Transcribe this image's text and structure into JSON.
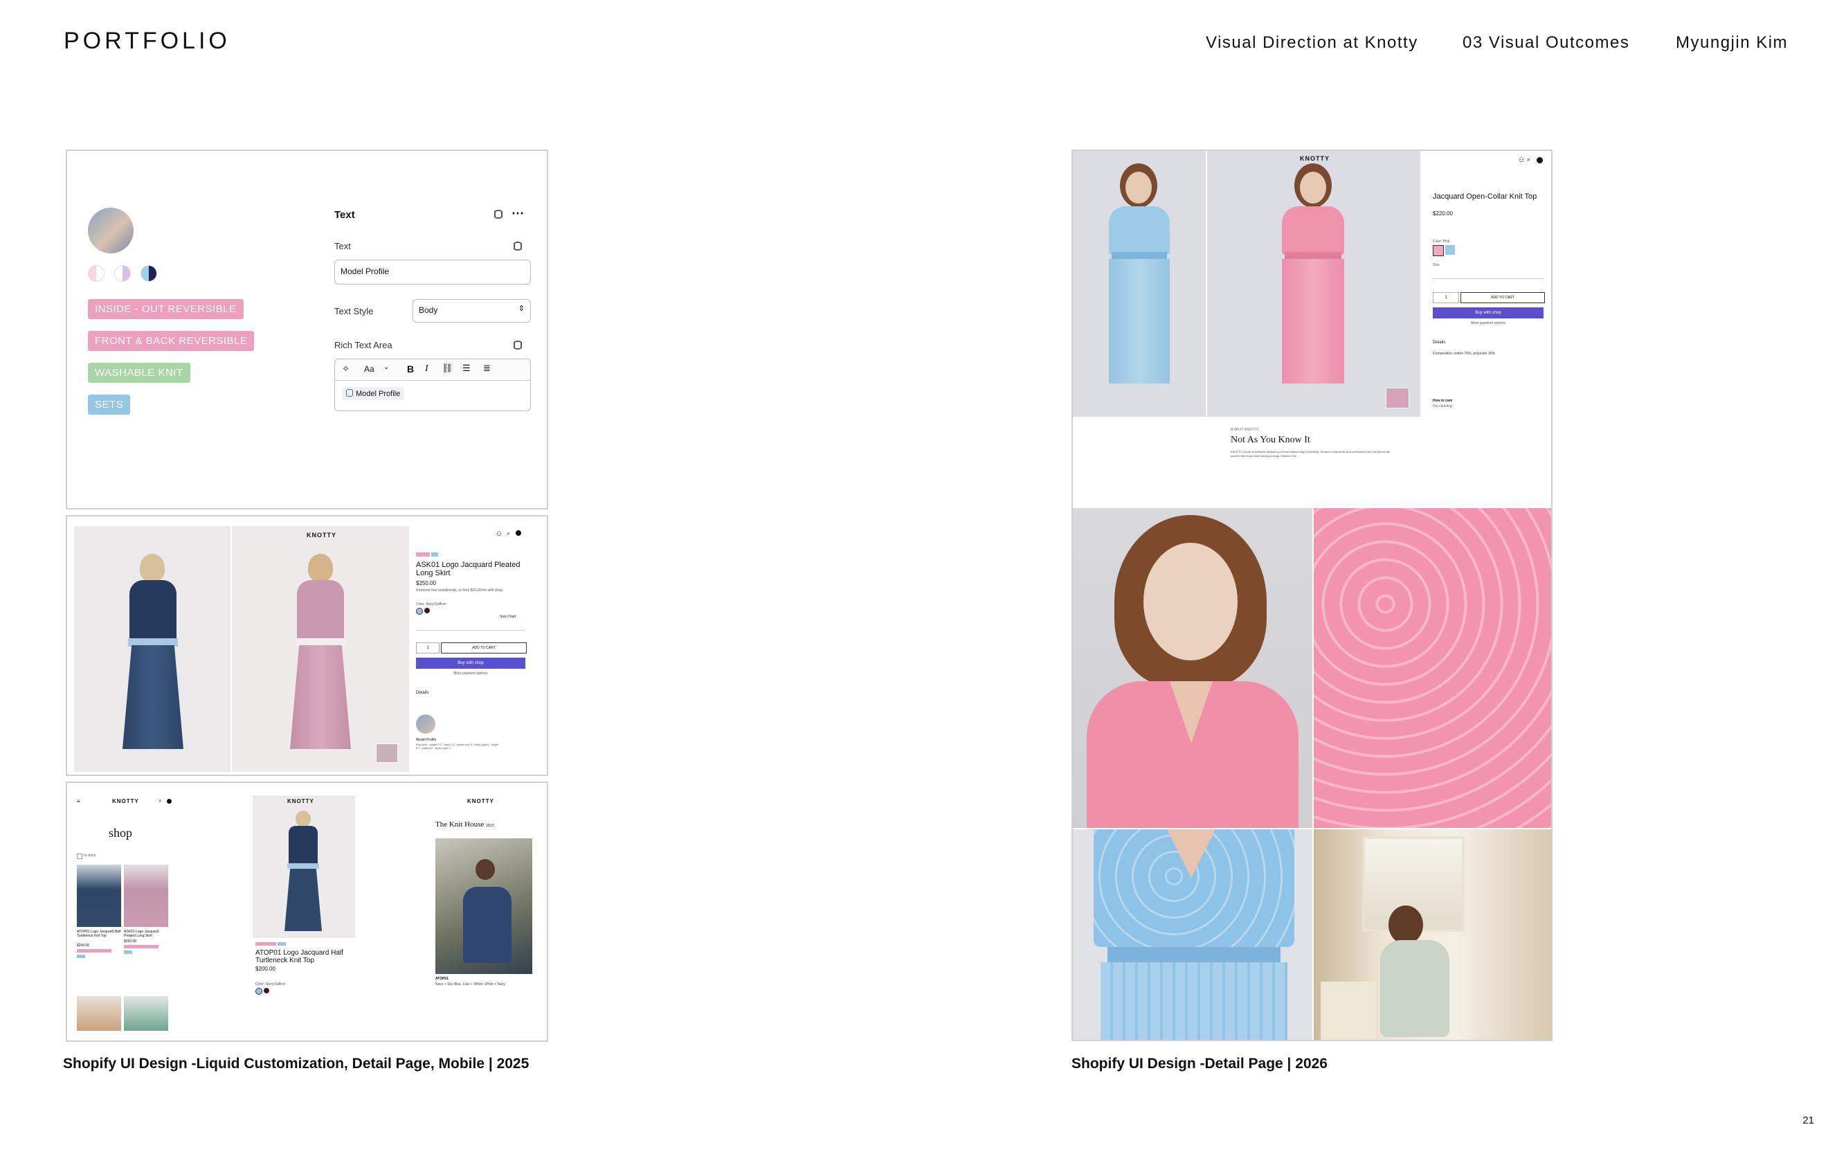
{
  "header": {
    "title": "PORTFOLIO",
    "nav": [
      "Visual Direction at Knotty",
      "03  Visual Outcomes",
      "Myungjin Kim"
    ]
  },
  "left": {
    "caption": "Shopify UI Design -Liquid Customization, Detail Page, Mobile | 2025",
    "editor": {
      "panel_title": "Text",
      "text_label": "Text",
      "text_value": "Model Profile",
      "text_style_label": "Text Style",
      "text_style_value": "Body",
      "rich_text_label": "Rich Text Area",
      "rich_chip": "Model Profile",
      "toolbar_font": "Aa",
      "tags": [
        "INSIDE - OUT  REVERSIBLE",
        "FRONT & BACK  REVERSIBLE",
        "WASHABLE KNIT",
        "SETS"
      ],
      "tag_colors": [
        "#ee9fbe",
        "#ee9fbe",
        "#a8d5a5",
        "#95c6e4"
      ]
    },
    "detail": {
      "brand": "KNOTTY",
      "product": "ASK01 Logo Jacquard Pleated Long Skirt",
      "price": "$250.00",
      "installments": "4 interest-free installments, or from $22.00/mo with shop",
      "color": "Color: Navy/Saffron",
      "size_chart": "Size Chart",
      "qty": "1",
      "add_to_cart": "ADD TO CART",
      "buy_with": "Buy with shop",
      "more_payment": "More payment options",
      "details": "Details",
      "model_profile": "Model Profile",
      "model_info": "Eva (left) : height 5'7\", waist 23\", wears size S. Stacy (right) : height 5'7\", waist 23\", wears size S."
    },
    "mobile": {
      "brand": "KNOTTY",
      "shop": "shop",
      "in_stock": "In stock",
      "item1": "ATOP01 Logo Jacquard Half Turtleneck Knit Top",
      "item1_price": "$200.00",
      "item2": "ASK01 Logo Jacquard Pleated Long Skirt",
      "item2_price": "$250.00",
      "product": "ATOP01 Logo Jacquard Half Turtleneck Knit Top",
      "price": "$200.00",
      "color": "Color: Navy/Saffron",
      "knit_house": "The Knit House",
      "knit_house_year": "2025",
      "knit_house_code": "ATOP01",
      "knit_house_colors": "Navy + Sky Blue, Lilac + White, White + Navy"
    }
  },
  "right": {
    "caption": "Shopify UI Design -Detail Page | 2026",
    "product": "Jacquard Open-Collar Knit Top",
    "price": "$220.00",
    "color_label": "Color: Pink",
    "size_label": "Size",
    "qty": "1",
    "add_to_cart": "ADD TO CART",
    "buy_with": "Buy with shop",
    "more_payment": "More payment options",
    "details": "Details",
    "composition": "Composition: cotton 70%, polyester 30%",
    "how_to_care": "How to care",
    "care": "Dry cleaning",
    "eyebrow": "A SPLIT KNOTTY",
    "story_title": "Not As You Know It",
    "story_body": "KNOTTY is built on knitwear, shaped by a more relaxed way of dressing. Rooted in knit denim and oversized forms, the pieces are made to feel easy while holding a sharp, feminine line."
  },
  "page_number": "21"
}
